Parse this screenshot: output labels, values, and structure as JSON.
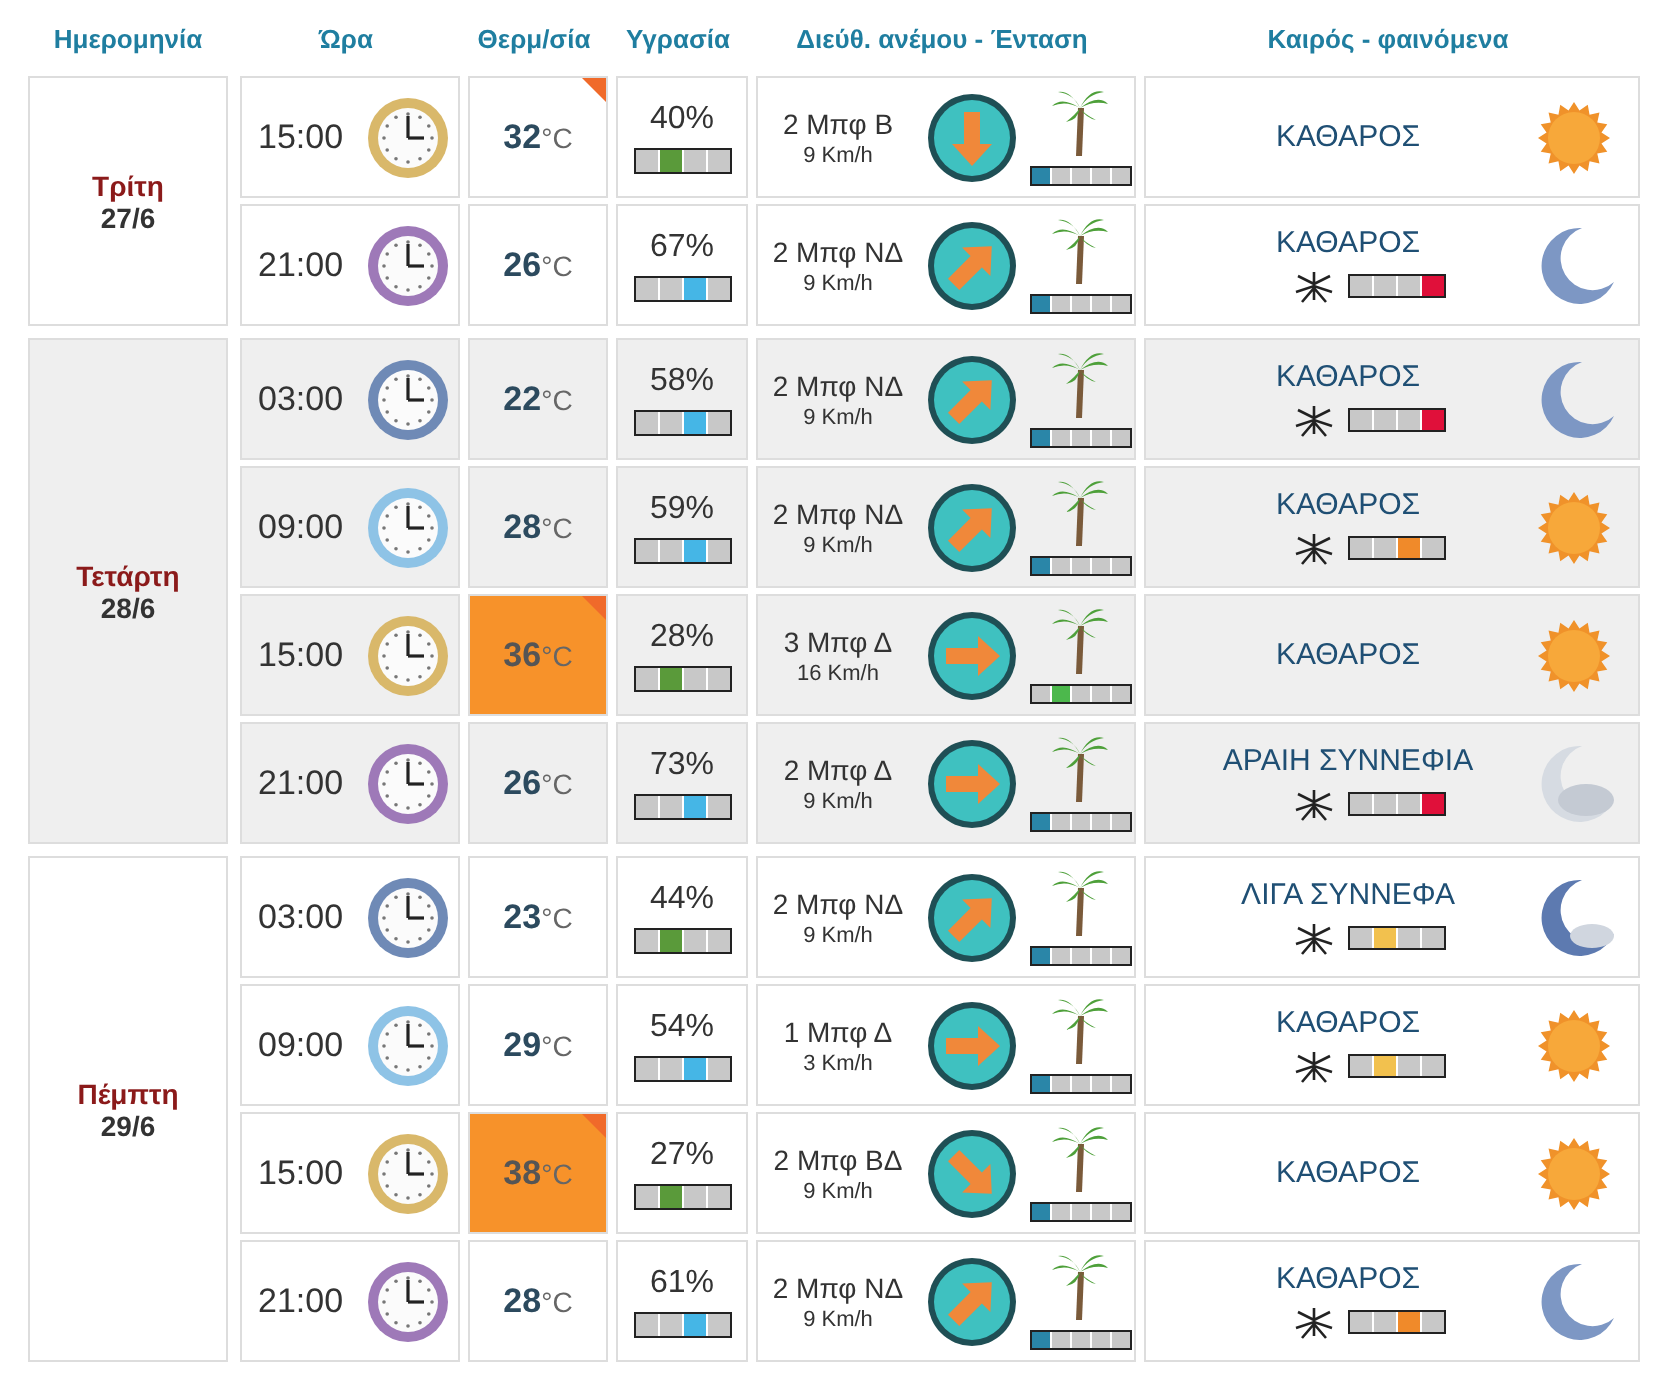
{
  "headers": [
    "Ημερομηνία",
    "Ώρα",
    "Θερμ/σία",
    "Υγρασία",
    "Διεύθ. ανέμου - Ένταση",
    "Καιρός - φαινόμενα"
  ],
  "days": [
    {
      "day": "Τρίτη",
      "date": "27/6",
      "shaded": false,
      "rows": [
        {
          "time": "15:00",
          "clock": {
            "kind": "afternoon"
          },
          "temp": "32",
          "unit": "°C",
          "hot": false,
          "flag": true,
          "humidity": {
            "text": "40%",
            "kind": "low"
          },
          "wind": {
            "force": "2 Μπφ Β",
            "speed": "9 Km/h",
            "kind": "down"
          },
          "wind_scale": {
            "kind": "light"
          },
          "sky": {
            "text": "ΚΑΘΑΡΟΣ",
            "kind": "sun"
          }
        },
        {
          "time": "21:00",
          "clock": {
            "kind": "night"
          },
          "temp": "26",
          "unit": "°C",
          "hot": false,
          "flag": false,
          "humidity": {
            "text": "67%",
            "kind": "mid"
          },
          "wind": {
            "force": "2 Μπφ ΝΔ",
            "speed": "9 Km/h",
            "kind": "upright"
          },
          "wind_scale": {
            "kind": "light"
          },
          "sky": {
            "text": "ΚΑΘΑΡΟΣ",
            "kind": "moon"
          },
          "mosquito": {
            "kind": "high"
          }
        }
      ]
    },
    {
      "day": "Τετάρτη",
      "date": "28/6",
      "shaded": true,
      "rows": [
        {
          "time": "03:00",
          "clock": {
            "kind": "early"
          },
          "temp": "22",
          "unit": "°C",
          "hot": false,
          "flag": false,
          "humidity": {
            "text": "58%",
            "kind": "mid"
          },
          "wind": {
            "force": "2 Μπφ ΝΔ",
            "speed": "9 Km/h",
            "kind": "upright"
          },
          "wind_scale": {
            "kind": "light"
          },
          "sky": {
            "text": "ΚΑΘΑΡΟΣ",
            "kind": "moon"
          },
          "mosquito": {
            "kind": "high"
          }
        },
        {
          "time": "09:00",
          "clock": {
            "kind": "morning"
          },
          "temp": "28",
          "unit": "°C",
          "hot": false,
          "flag": false,
          "humidity": {
            "text": "59%",
            "kind": "mid"
          },
          "wind": {
            "force": "2 Μπφ ΝΔ",
            "speed": "9 Km/h",
            "kind": "upright"
          },
          "wind_scale": {
            "kind": "light"
          },
          "sky": {
            "text": "ΚΑΘΑΡΟΣ",
            "kind": "sun"
          },
          "mosquito": {
            "kind": "medium"
          }
        },
        {
          "time": "15:00",
          "clock": {
            "kind": "afternoon"
          },
          "temp": "36",
          "unit": "°C",
          "hot": true,
          "flag": true,
          "humidity": {
            "text": "28%",
            "kind": "low"
          },
          "wind": {
            "force": "3 Μπφ Δ",
            "speed": "16 Km/h",
            "kind": "right"
          },
          "wind_scale": {
            "kind": "moderate"
          },
          "sky": {
            "text": "ΚΑΘΑΡΟΣ",
            "kind": "sun"
          }
        },
        {
          "time": "21:00",
          "clock": {
            "kind": "night"
          },
          "temp": "26",
          "unit": "°C",
          "hot": false,
          "flag": false,
          "humidity": {
            "text": "73%",
            "kind": "mid"
          },
          "wind": {
            "force": "2 Μπφ Δ",
            "speed": "9 Km/h",
            "kind": "right"
          },
          "wind_scale": {
            "kind": "light"
          },
          "sky": {
            "text": "ΑΡΑΙΗ ΣΥΝΝΕΦΙΑ",
            "kind": "palecloud"
          },
          "mosquito": {
            "kind": "high"
          }
        }
      ]
    },
    {
      "day": "Πέμπτη",
      "date": "29/6",
      "shaded": false,
      "rows": [
        {
          "time": "03:00",
          "clock": {
            "kind": "early"
          },
          "temp": "23",
          "unit": "°C",
          "hot": false,
          "flag": false,
          "humidity": {
            "text": "44%",
            "kind": "low"
          },
          "wind": {
            "force": "2 Μπφ ΝΔ",
            "speed": "9 Km/h",
            "kind": "upright"
          },
          "wind_scale": {
            "kind": "light"
          },
          "sky": {
            "text": "ΛΙΓΑ ΣΥΝΝΕΦΑ",
            "kind": "mooncloud"
          },
          "mosquito": {
            "kind": "low"
          }
        },
        {
          "time": "09:00",
          "clock": {
            "kind": "morning"
          },
          "temp": "29",
          "unit": "°C",
          "hot": false,
          "flag": false,
          "humidity": {
            "text": "54%",
            "kind": "mid"
          },
          "wind": {
            "force": "1 Μπφ Δ",
            "speed": "3 Km/h",
            "kind": "right"
          },
          "wind_scale": {
            "kind": "light"
          },
          "sky": {
            "text": "ΚΑΘΑΡΟΣ",
            "kind": "sun"
          },
          "mosquito": {
            "kind": "low"
          }
        },
        {
          "time": "15:00",
          "clock": {
            "kind": "afternoon"
          },
          "temp": "38",
          "unit": "°C",
          "hot": true,
          "flag": true,
          "humidity": {
            "text": "27%",
            "kind": "low"
          },
          "wind": {
            "force": "2 Μπφ ΒΔ",
            "speed": "9 Km/h",
            "kind": "downright"
          },
          "wind_scale": {
            "kind": "light"
          },
          "sky": {
            "text": "ΚΑΘΑΡΟΣ",
            "kind": "sun"
          }
        },
        {
          "time": "21:00",
          "clock": {
            "kind": "night"
          },
          "temp": "28",
          "unit": "°C",
          "hot": false,
          "flag": false,
          "humidity": {
            "text": "61%",
            "kind": "mid"
          },
          "wind": {
            "force": "2 Μπφ ΝΔ",
            "speed": "9 Km/h",
            "kind": "upright"
          },
          "wind_scale": {
            "kind": "light"
          },
          "sky": {
            "text": "ΚΑΘΑΡΟΣ",
            "kind": "moon"
          },
          "mosquito": {
            "kind": "medium"
          }
        }
      ]
    }
  ]
}
